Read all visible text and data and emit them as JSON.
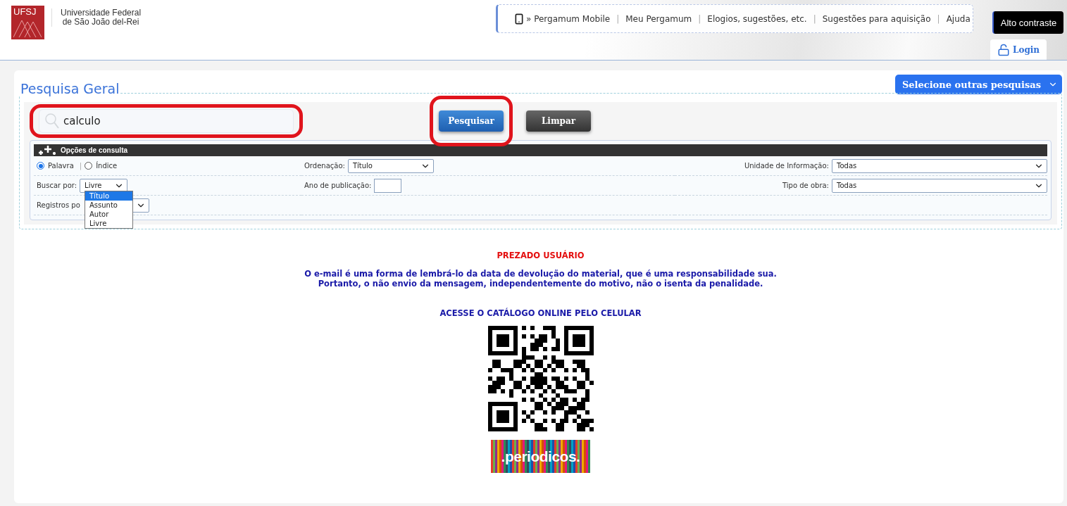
{
  "header": {
    "logo": "UFSJ",
    "university": [
      "Universidade Federal",
      "de São João del-Rei"
    ],
    "nav": [
      {
        "label": "» Pergamum Mobile",
        "kind": "mobile"
      },
      {
        "label": "Meu Pergamum",
        "kind": "link"
      },
      {
        "label": "Elogios, sugestões, etc.",
        "kind": "link"
      },
      {
        "label": "Sugestões para aquisição",
        "kind": "link"
      },
      {
        "label": "Ajuda",
        "kind": "link"
      }
    ],
    "separator": "|",
    "contrast_button": "Alto contraste",
    "login": "Login"
  },
  "search": {
    "legend": "Pesquisa Geral",
    "other_searches": "Selecione outras pesquisas",
    "query": "calculo",
    "query_highlighted": true,
    "buttons": [
      {
        "label": "Pesquisar",
        "kind": "primary",
        "highlighted": true
      },
      {
        "label": "Limpar",
        "kind": "secondary",
        "highlighted": false
      }
    ]
  },
  "options": {
    "title": "Opções de consulta",
    "mode": [
      {
        "label": "Palavra",
        "selected": true
      },
      {
        "label": "Índice",
        "selected": false
      }
    ],
    "mode_separator": "|",
    "buscar_label": "Buscar por:",
    "buscar_value": "Livre",
    "buscar_menu": [
      {
        "label": "Título",
        "selected": true
      },
      {
        "label": "Assunto",
        "selected": false
      },
      {
        "label": "Autor",
        "selected": false
      },
      {
        "label": "Livre",
        "selected": false
      }
    ],
    "registros_label": "Registros po",
    "ordenacao_label": "Ordenação:",
    "ordenacao_value": "Título",
    "ano_label": "Ano de publicação:",
    "unidade_label": "Unidade de Informação:",
    "unidade_value": "Todas",
    "tipo_label": "Tipo de obra:",
    "tipo_value": "Todas"
  },
  "notice": {
    "title": "PREZADO USUÁRIO",
    "lines": [
      "O e-mail é uma forma de lembrá-lo da data de devolução do material, que é uma responsabilidade sua.",
      "Portanto, o não envio da mensagem, independentemente do motivo, não o isenta da penalidade."
    ],
    "catalog": "ACESSE O CATÁLOGO ONLINE PELO CELULAR",
    "periodicos": ".periodicos."
  }
}
